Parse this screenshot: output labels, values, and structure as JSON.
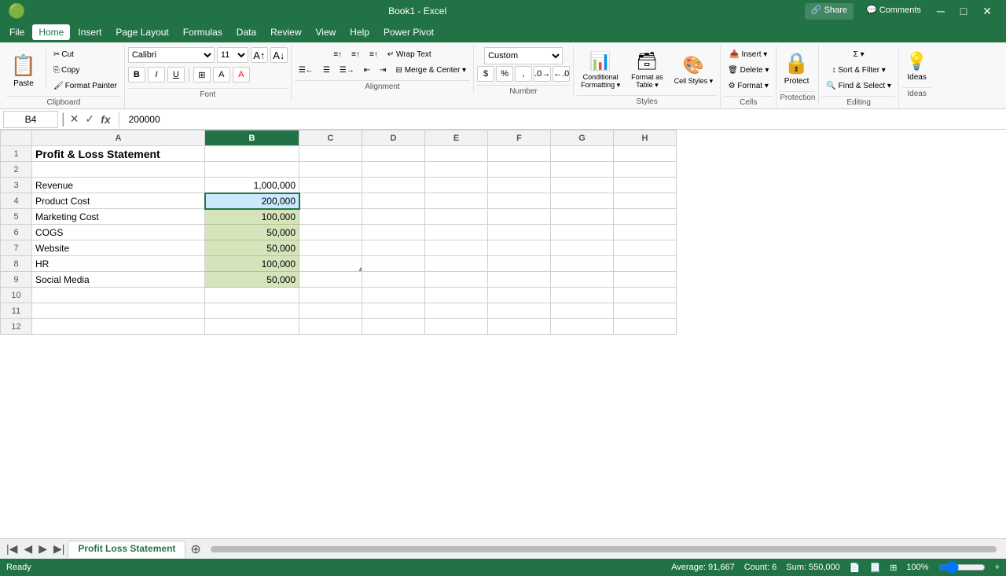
{
  "app": {
    "title": "Microsoft Excel",
    "file_name": "Book1 - Excel"
  },
  "menu": {
    "items": [
      "File",
      "Home",
      "Insert",
      "Page Layout",
      "Formulas",
      "Data",
      "Review",
      "View",
      "Help",
      "Power Pivot"
    ],
    "active": "Home"
  },
  "ribbon": {
    "clipboard": {
      "label": "Clipboard",
      "paste_label": "Paste",
      "cut_label": "Cut",
      "copy_label": "Copy",
      "format_painter_label": "Format Painter"
    },
    "font": {
      "label": "Font",
      "font_name": "Calibri",
      "font_size": "11",
      "bold": "B",
      "italic": "I",
      "underline": "U",
      "borders_label": "Borders",
      "fill_color_label": "Fill Color",
      "font_color_label": "Font Color"
    },
    "alignment": {
      "label": "Alignment",
      "wrap_text_label": "Wrap Text",
      "merge_center_label": "Merge & Center"
    },
    "number": {
      "label": "Number",
      "format": "Custom",
      "currency_label": "$",
      "percent_label": "%",
      "comma_label": ","
    },
    "styles": {
      "label": "Styles",
      "conditional_label": "Conditional Formatting",
      "format_table_label": "Format as Table",
      "cell_styles_label": "Cell Styles"
    },
    "cells": {
      "label": "Cells",
      "insert_label": "Insert",
      "delete_label": "Delete",
      "format_label": "Format"
    },
    "editing": {
      "label": "Editing",
      "sum_label": "Sum",
      "sort_filter_label": "Sort & Filter",
      "find_select_label": "Find & Select"
    },
    "ideas": {
      "label": "Ideas",
      "ideas_label": "Ideas"
    },
    "protection": {
      "label": "Protection",
      "protect_label": "Protect"
    }
  },
  "formula_bar": {
    "cell_ref": "B4",
    "formula_value": "200000",
    "cancel_symbol": "✕",
    "confirm_symbol": "✓",
    "fx_symbol": "fx"
  },
  "columns": [
    "",
    "A",
    "B",
    "C",
    "D",
    "E",
    "F",
    "G",
    "H"
  ],
  "rows": [
    {
      "row": 1,
      "cells": [
        "Profit & Loss Statement",
        "",
        "",
        "",
        "",
        "",
        "",
        ""
      ]
    },
    {
      "row": 2,
      "cells": [
        "",
        "",
        "",
        "",
        "",
        "",
        "",
        ""
      ]
    },
    {
      "row": 3,
      "cells": [
        "Revenue",
        "1,000,000",
        "",
        "",
        "",
        "",
        "",
        ""
      ]
    },
    {
      "row": 4,
      "cells": [
        "Product Cost",
        "200,000",
        "",
        "",
        "",
        "",
        "",
        ""
      ]
    },
    {
      "row": 5,
      "cells": [
        "Marketing Cost",
        "100,000",
        "",
        "",
        "",
        "",
        "",
        ""
      ]
    },
    {
      "row": 6,
      "cells": [
        "COGS",
        "50,000",
        "",
        "",
        "",
        "",
        "",
        ""
      ]
    },
    {
      "row": 7,
      "cells": [
        "Website",
        "50,000",
        "",
        "",
        "",
        "",
        "",
        ""
      ]
    },
    {
      "row": 8,
      "cells": [
        "HR",
        "100,000",
        "",
        "",
        "",
        "",
        "",
        ""
      ]
    },
    {
      "row": 9,
      "cells": [
        "Social Media",
        "50,000",
        "",
        "",
        "",
        "",
        "",
        ""
      ]
    },
    {
      "row": 10,
      "cells": [
        "",
        "",
        "",
        "",
        "",
        "",
        "",
        ""
      ]
    },
    {
      "row": 11,
      "cells": [
        "",
        "",
        "",
        "",
        "",
        "",
        "",
        ""
      ]
    },
    {
      "row": 12,
      "cells": [
        "",
        "",
        "",
        "",
        "",
        "",
        "",
        ""
      ]
    }
  ],
  "selected_cell": {
    "col": "B",
    "row": 4
  },
  "selected_range": {
    "col": "B",
    "rows": [
      4,
      5,
      6,
      7,
      8,
      9
    ]
  },
  "sheet_tabs": [
    {
      "name": "Profit Loss Statement",
      "active": true
    }
  ],
  "status_bar": {
    "ready": "Ready",
    "average": "Average: 91,667",
    "count": "Count: 6",
    "sum": "Sum: 550,000"
  },
  "cursor_icon": "⊕"
}
